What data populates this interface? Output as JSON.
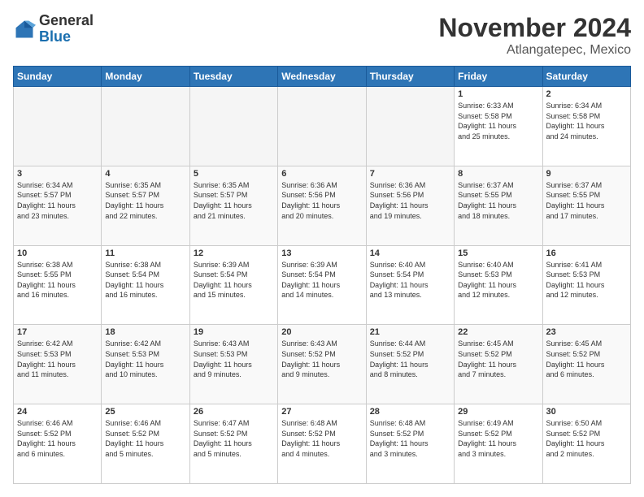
{
  "logo": {
    "general": "General",
    "blue": "Blue"
  },
  "header": {
    "month": "November 2024",
    "location": "Atlangatepec, Mexico"
  },
  "weekdays": [
    "Sunday",
    "Monday",
    "Tuesday",
    "Wednesday",
    "Thursday",
    "Friday",
    "Saturday"
  ],
  "weeks": [
    [
      {
        "day": "",
        "info": ""
      },
      {
        "day": "",
        "info": ""
      },
      {
        "day": "",
        "info": ""
      },
      {
        "day": "",
        "info": ""
      },
      {
        "day": "",
        "info": ""
      },
      {
        "day": "1",
        "info": "Sunrise: 6:33 AM\nSunset: 5:58 PM\nDaylight: 11 hours\nand 25 minutes."
      },
      {
        "day": "2",
        "info": "Sunrise: 6:34 AM\nSunset: 5:58 PM\nDaylight: 11 hours\nand 24 minutes."
      }
    ],
    [
      {
        "day": "3",
        "info": "Sunrise: 6:34 AM\nSunset: 5:57 PM\nDaylight: 11 hours\nand 23 minutes."
      },
      {
        "day": "4",
        "info": "Sunrise: 6:35 AM\nSunset: 5:57 PM\nDaylight: 11 hours\nand 22 minutes."
      },
      {
        "day": "5",
        "info": "Sunrise: 6:35 AM\nSunset: 5:57 PM\nDaylight: 11 hours\nand 21 minutes."
      },
      {
        "day": "6",
        "info": "Sunrise: 6:36 AM\nSunset: 5:56 PM\nDaylight: 11 hours\nand 20 minutes."
      },
      {
        "day": "7",
        "info": "Sunrise: 6:36 AM\nSunset: 5:56 PM\nDaylight: 11 hours\nand 19 minutes."
      },
      {
        "day": "8",
        "info": "Sunrise: 6:37 AM\nSunset: 5:55 PM\nDaylight: 11 hours\nand 18 minutes."
      },
      {
        "day": "9",
        "info": "Sunrise: 6:37 AM\nSunset: 5:55 PM\nDaylight: 11 hours\nand 17 minutes."
      }
    ],
    [
      {
        "day": "10",
        "info": "Sunrise: 6:38 AM\nSunset: 5:55 PM\nDaylight: 11 hours\nand 16 minutes."
      },
      {
        "day": "11",
        "info": "Sunrise: 6:38 AM\nSunset: 5:54 PM\nDaylight: 11 hours\nand 16 minutes."
      },
      {
        "day": "12",
        "info": "Sunrise: 6:39 AM\nSunset: 5:54 PM\nDaylight: 11 hours\nand 15 minutes."
      },
      {
        "day": "13",
        "info": "Sunrise: 6:39 AM\nSunset: 5:54 PM\nDaylight: 11 hours\nand 14 minutes."
      },
      {
        "day": "14",
        "info": "Sunrise: 6:40 AM\nSunset: 5:54 PM\nDaylight: 11 hours\nand 13 minutes."
      },
      {
        "day": "15",
        "info": "Sunrise: 6:40 AM\nSunset: 5:53 PM\nDaylight: 11 hours\nand 12 minutes."
      },
      {
        "day": "16",
        "info": "Sunrise: 6:41 AM\nSunset: 5:53 PM\nDaylight: 11 hours\nand 12 minutes."
      }
    ],
    [
      {
        "day": "17",
        "info": "Sunrise: 6:42 AM\nSunset: 5:53 PM\nDaylight: 11 hours\nand 11 minutes."
      },
      {
        "day": "18",
        "info": "Sunrise: 6:42 AM\nSunset: 5:53 PM\nDaylight: 11 hours\nand 10 minutes."
      },
      {
        "day": "19",
        "info": "Sunrise: 6:43 AM\nSunset: 5:53 PM\nDaylight: 11 hours\nand 9 minutes."
      },
      {
        "day": "20",
        "info": "Sunrise: 6:43 AM\nSunset: 5:52 PM\nDaylight: 11 hours\nand 9 minutes."
      },
      {
        "day": "21",
        "info": "Sunrise: 6:44 AM\nSunset: 5:52 PM\nDaylight: 11 hours\nand 8 minutes."
      },
      {
        "day": "22",
        "info": "Sunrise: 6:45 AM\nSunset: 5:52 PM\nDaylight: 11 hours\nand 7 minutes."
      },
      {
        "day": "23",
        "info": "Sunrise: 6:45 AM\nSunset: 5:52 PM\nDaylight: 11 hours\nand 6 minutes."
      }
    ],
    [
      {
        "day": "24",
        "info": "Sunrise: 6:46 AM\nSunset: 5:52 PM\nDaylight: 11 hours\nand 6 minutes."
      },
      {
        "day": "25",
        "info": "Sunrise: 6:46 AM\nSunset: 5:52 PM\nDaylight: 11 hours\nand 5 minutes."
      },
      {
        "day": "26",
        "info": "Sunrise: 6:47 AM\nSunset: 5:52 PM\nDaylight: 11 hours\nand 5 minutes."
      },
      {
        "day": "27",
        "info": "Sunrise: 6:48 AM\nSunset: 5:52 PM\nDaylight: 11 hours\nand 4 minutes."
      },
      {
        "day": "28",
        "info": "Sunrise: 6:48 AM\nSunset: 5:52 PM\nDaylight: 11 hours\nand 3 minutes."
      },
      {
        "day": "29",
        "info": "Sunrise: 6:49 AM\nSunset: 5:52 PM\nDaylight: 11 hours\nand 3 minutes."
      },
      {
        "day": "30",
        "info": "Sunrise: 6:50 AM\nSunset: 5:52 PM\nDaylight: 11 hours\nand 2 minutes."
      }
    ]
  ]
}
